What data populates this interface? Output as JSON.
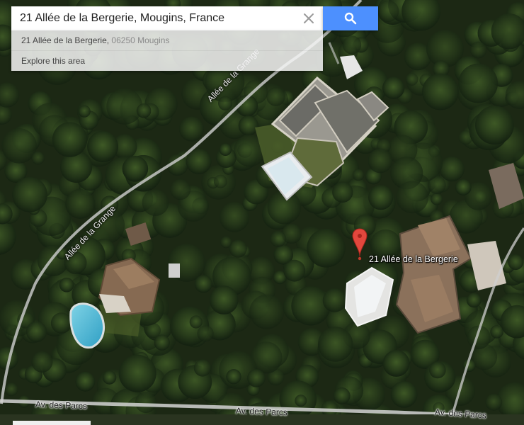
{
  "search": {
    "query": "21 Allée de la Bergerie, Mougins, France",
    "clear_icon": "close-icon",
    "button_icon": "search-icon",
    "button_color": "#4d90fe"
  },
  "suggestions": [
    {
      "main": "21 Allée de la Bergerie, ",
      "secondary": "06250 Mougins"
    },
    {
      "main": "Explore this area",
      "secondary": ""
    }
  ],
  "map": {
    "view": "satellite",
    "marker": {
      "label": "21 Allée de la Bergerie",
      "icon": "map-pin-icon",
      "color": "#e2473d"
    },
    "roads": [
      {
        "name": "Allée de la Grange"
      },
      {
        "name": "Allée de la Grange"
      },
      {
        "name": "Av. des Parcs"
      },
      {
        "name": "Av. des Parcs"
      },
      {
        "name": "Av. des Parcs"
      }
    ]
  }
}
